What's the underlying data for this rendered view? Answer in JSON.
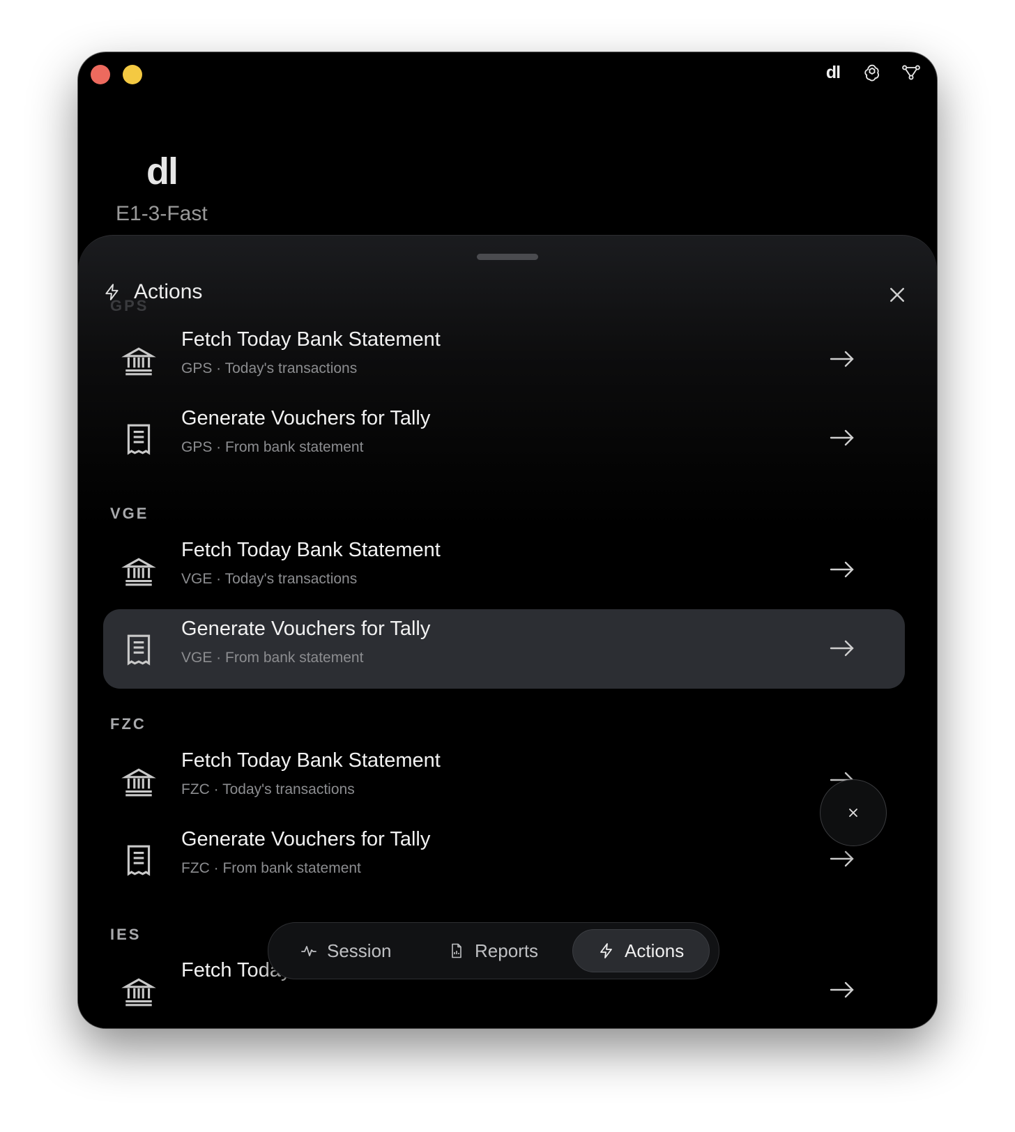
{
  "app": {
    "logo_text": "dl",
    "header_logo": "dl",
    "model_name": "E1-3-Fast"
  },
  "top_icons": [
    "dl-logo-icon",
    "openai-icon",
    "network-icon"
  ],
  "sheet": {
    "title": "Actions",
    "ghost_section": "GPS"
  },
  "sections": [
    {
      "label": "GPS",
      "items": [
        {
          "title": "Fetch Today Bank Statement",
          "subtitle": "GPS · Today's transactions",
          "icon": "bank-icon",
          "selected": false
        },
        {
          "title": "Generate Vouchers for Tally",
          "subtitle": "GPS · From bank statement",
          "icon": "receipt-icon",
          "selected": false
        }
      ]
    },
    {
      "label": "VGE",
      "items": [
        {
          "title": "Fetch Today Bank Statement",
          "subtitle": "VGE · Today's transactions",
          "icon": "bank-icon",
          "selected": false
        },
        {
          "title": "Generate Vouchers for Tally",
          "subtitle": "VGE · From bank statement",
          "icon": "receipt-icon",
          "selected": true
        }
      ]
    },
    {
      "label": "FZC",
      "items": [
        {
          "title": "Fetch Today Bank Statement",
          "subtitle": "FZC · Today's transactions",
          "icon": "bank-icon",
          "selected": false
        },
        {
          "title": "Generate Vouchers for Tally",
          "subtitle": "FZC · From bank statement",
          "icon": "receipt-icon",
          "selected": false
        }
      ]
    },
    {
      "label": "IES",
      "items": [
        {
          "title": "Fetch Today Bank Statement",
          "subtitle": "",
          "icon": "bank-icon",
          "selected": false
        }
      ]
    }
  ],
  "tabs": [
    {
      "label": "Session",
      "icon": "pulse-icon",
      "active": false
    },
    {
      "label": "Reports",
      "icon": "document-icon",
      "active": false
    },
    {
      "label": "Actions",
      "icon": "lightning-icon",
      "active": true
    }
  ],
  "colors": {
    "background": "#000000",
    "selected_row": "#2c2e33",
    "traffic_red": "#ed6a5e",
    "traffic_yellow": "#f4c942"
  }
}
